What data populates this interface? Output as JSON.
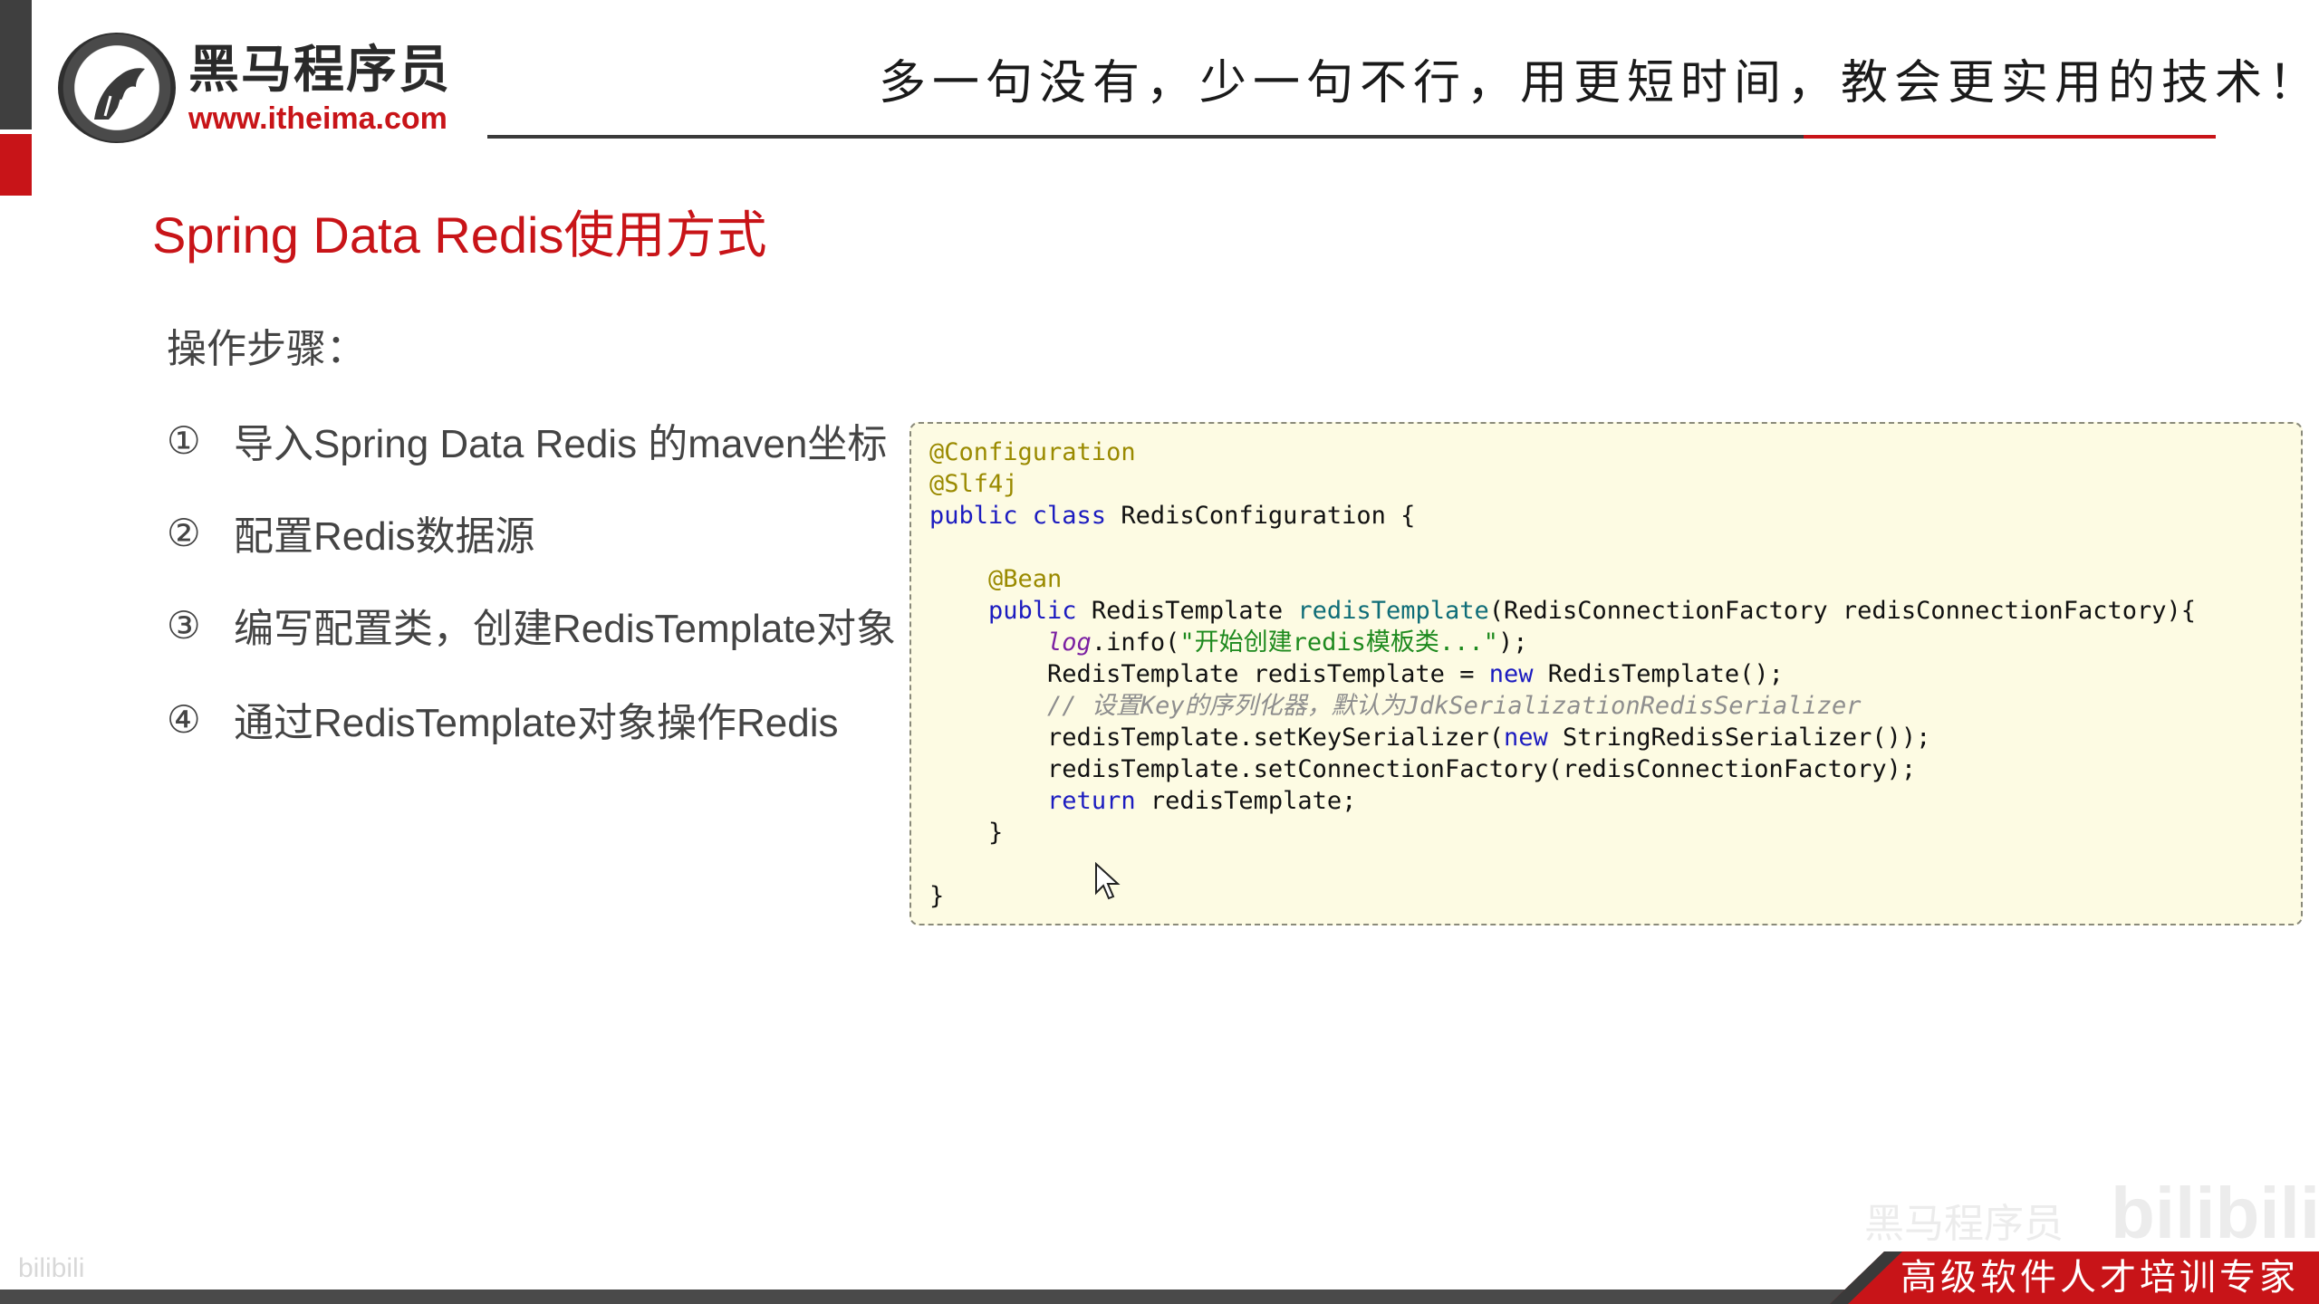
{
  "header": {
    "brand_name": "黑马程序员",
    "brand_url": "www.itheima.com",
    "slogan": "多一句没有，少一句不行，用更短时间，教会更实用的技术！",
    "accent_red": "#c81418"
  },
  "slide": {
    "title": "Spring Data Redis使用方式",
    "steps_heading": "操作步骤：",
    "steps": [
      {
        "num": "①",
        "text": "导入Spring Data Redis 的maven坐标"
      },
      {
        "num": "②",
        "text": "配置Redis数据源"
      },
      {
        "num": "③",
        "text": "编写配置类，创建RedisTemplate对象"
      },
      {
        "num": "④",
        "text": "通过RedisTemplate对象操作Redis"
      }
    ]
  },
  "code": {
    "l1": "@Configuration",
    "l2": "@Slf4j",
    "l3_kw": "public class",
    "l3_name": " RedisConfiguration {",
    "l5": "@Bean",
    "l6_kw": "public",
    "l6_type": " RedisTemplate ",
    "l6_method": "redisTemplate",
    "l6_params": "(RedisConnectionFactory redisConnectionFactory){",
    "l7_log": "log",
    "l7_call": ".info(",
    "l7_str": "\"开始创建redis模板类...\"",
    "l7_end": ");",
    "l8_a": "RedisTemplate redisTemplate = ",
    "l8_kw": "new",
    "l8_b": " RedisTemplate();",
    "l9_comment": "// 设置Key的序列化器，默认为JdkSerializationRedisSerializer",
    "l10_a": "redisTemplate.setKeySerializer(",
    "l10_kw": "new",
    "l10_b": " StringRedisSerializer());",
    "l11": "redisTemplate.setConnectionFactory(redisConnectionFactory);",
    "l12_kw": "return",
    "l12_b": " redisTemplate;",
    "l13": "}",
    "l15": "}"
  },
  "footer": {
    "tagline": "高级软件人才培训专家"
  },
  "watermark": {
    "text": "黑马程序员",
    "logo": "bilibili",
    "small": "bilibili"
  }
}
